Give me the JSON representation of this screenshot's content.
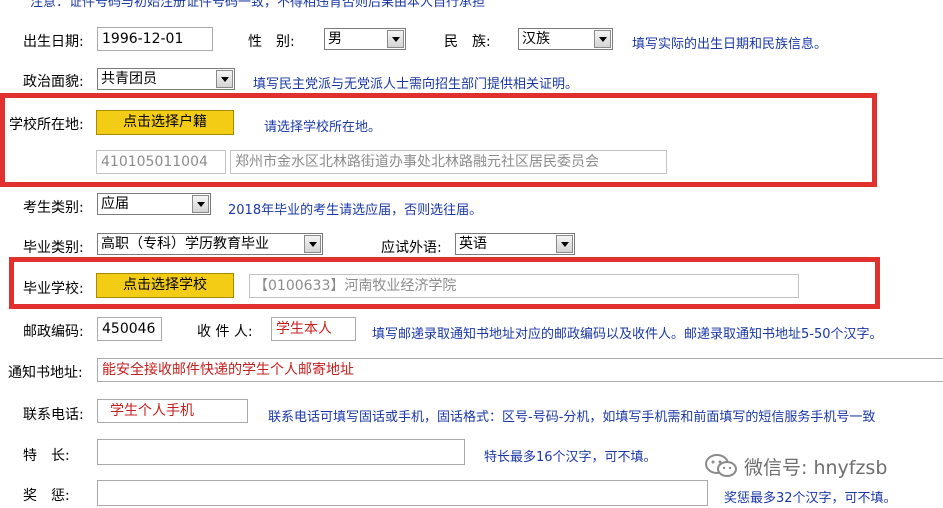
{
  "top_cut_text": "注意：证件号码与初始注册证件号码一致，不得相违背否则后果由本人自行承担",
  "birth": {
    "label": "出生日期:",
    "value": "1996-12-01"
  },
  "gender": {
    "label": "性　别:",
    "value": "男"
  },
  "ethnic": {
    "label": "民　族:",
    "value": "汉族"
  },
  "row1_hint": "填写实际的出生日期和民族信息。",
  "political": {
    "label": "政治面貌:",
    "value": "共青团员",
    "hint": "填写民主党派与无党派人士需向招生部门提供相关证明。"
  },
  "school_location": {
    "label": "学校所在地:",
    "button": "点击选择户籍",
    "hint": "请选择学校所在地。",
    "code": "410105011004",
    "address": "郑州市金水区北林路街道办事处北林路融元社区居民委员会"
  },
  "candidate_type": {
    "label": "考生类别:",
    "value": "应届",
    "hint": "2018年毕业的考生请选应届，否则选往届。"
  },
  "grad_type": {
    "label": "毕业类别:",
    "value": "高职（专科）学历教育毕业"
  },
  "foreign_lang": {
    "label": "应试外语:",
    "value": "英语"
  },
  "grad_school": {
    "label": "毕业学校:",
    "button": "点击选择学校",
    "value": "【0100633】河南牧业经济学院"
  },
  "postcode": {
    "label": "邮政编码:",
    "value": "450046"
  },
  "recipient": {
    "label": "收 件 人:",
    "value": "学生本人",
    "hint": "填写邮递录取通知书地址对应的邮政编码以及收件人。邮递录取通知书地址5-50个汉字。"
  },
  "mail_address": {
    "label": "通知书地址:",
    "value": "能安全接收邮件快递的学生个人邮寄地址"
  },
  "phone": {
    "label": "联系电话:",
    "value": "学生个人手机",
    "hint": "联系电话可填写固话或手机，固话格式：区号-号码-分机，如填写手机需和前面填写的短信服务手机号一致"
  },
  "specialty": {
    "label": "特　长:",
    "hint": "特长最多16个汉字，可不填。"
  },
  "awards": {
    "label": "奖　惩:",
    "hint": "奖惩最多32个汉字，可不填。"
  },
  "watermark": "微信号: hnyfzsb",
  "colors": {
    "hint_blue": "#1a37a8",
    "highlight_red": "#e0312f",
    "button_yellow": "#f3cd15",
    "value_red": "#c3201d"
  }
}
